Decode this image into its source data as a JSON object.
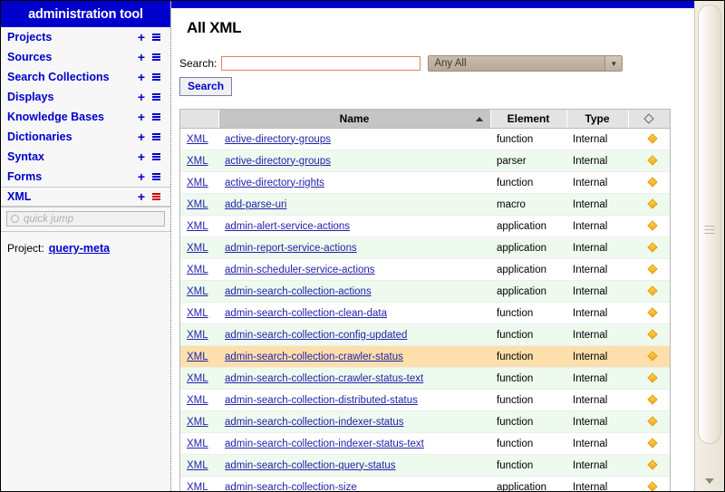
{
  "brand": {
    "title": "administration tool"
  },
  "sidebar": {
    "items": [
      {
        "label": "Projects",
        "add_icon": "plus-icon",
        "menu_icon": "hamburger-icon",
        "current": false
      },
      {
        "label": "Sources",
        "add_icon": "plus-icon",
        "menu_icon": "hamburger-icon",
        "current": false
      },
      {
        "label": "Search Collections",
        "add_icon": "plus-icon",
        "menu_icon": "hamburger-icon",
        "current": false
      },
      {
        "label": "Displays",
        "add_icon": "plus-icon",
        "menu_icon": "hamburger-icon",
        "current": false
      },
      {
        "label": "Knowledge Bases",
        "add_icon": "plus-icon",
        "menu_icon": "hamburger-icon",
        "current": false
      },
      {
        "label": "Dictionaries",
        "add_icon": "plus-icon",
        "menu_icon": "hamburger-icon",
        "current": false
      },
      {
        "label": "Syntax",
        "add_icon": "plus-icon",
        "menu_icon": "hamburger-icon",
        "current": false
      },
      {
        "label": "Forms",
        "add_icon": "plus-icon",
        "menu_icon": "hamburger-icon",
        "current": false
      },
      {
        "label": "XML",
        "add_icon": "plus-icon",
        "menu_icon": "hamburger-icon",
        "current": true
      }
    ],
    "quick_jump": {
      "icon": "circle-icon",
      "placeholder": "quick jump",
      "value": ""
    },
    "project": {
      "label": "Project:",
      "value": "query-meta"
    }
  },
  "main": {
    "page_title": "All XML",
    "search": {
      "label": "Search:",
      "value": "",
      "placeholder": "",
      "scope_selected": "Any All",
      "scope_arrow_icon": "chevron-down-icon",
      "button_label": "Search"
    },
    "table": {
      "columns": [
        "",
        "Name",
        "Element",
        "Type",
        "◇"
      ],
      "sorted_column": "Name",
      "sort_direction": "asc",
      "sort_icon": "caret-up-icon",
      "flag_header_icon": "diamond-outline-icon",
      "link_label": "XML",
      "rows": [
        {
          "link": "XML",
          "name": "active-directory-groups",
          "element": "function",
          "type": "Internal",
          "flag": "diamond-icon",
          "highlight": false
        },
        {
          "link": "XML",
          "name": "active-directory-groups",
          "element": "parser",
          "type": "Internal",
          "flag": "diamond-icon",
          "highlight": false
        },
        {
          "link": "XML",
          "name": "active-directory-rights",
          "element": "function",
          "type": "Internal",
          "flag": "diamond-icon",
          "highlight": false
        },
        {
          "link": "XML",
          "name": "add-parse-uri",
          "element": "macro",
          "type": "Internal",
          "flag": "diamond-icon",
          "highlight": false
        },
        {
          "link": "XML",
          "name": "admin-alert-service-actions",
          "element": "application",
          "type": "Internal",
          "flag": "diamond-icon",
          "highlight": false
        },
        {
          "link": "XML",
          "name": "admin-report-service-actions",
          "element": "application",
          "type": "Internal",
          "flag": "diamond-icon",
          "highlight": false
        },
        {
          "link": "XML",
          "name": "admin-scheduler-service-actions",
          "element": "application",
          "type": "Internal",
          "flag": "diamond-icon",
          "highlight": false
        },
        {
          "link": "XML",
          "name": "admin-search-collection-actions",
          "element": "application",
          "type": "Internal",
          "flag": "diamond-icon",
          "highlight": false
        },
        {
          "link": "XML",
          "name": "admin-search-collection-clean-data",
          "element": "function",
          "type": "Internal",
          "flag": "diamond-icon",
          "highlight": false
        },
        {
          "link": "XML",
          "name": "admin-search-collection-config-updated",
          "element": "function",
          "type": "Internal",
          "flag": "diamond-icon",
          "highlight": false
        },
        {
          "link": "XML",
          "name": "admin-search-collection-crawler-status",
          "element": "function",
          "type": "Internal",
          "flag": "diamond-icon",
          "highlight": true
        },
        {
          "link": "XML",
          "name": "admin-search-collection-crawler-status-text",
          "element": "function",
          "type": "Internal",
          "flag": "diamond-icon",
          "highlight": false
        },
        {
          "link": "XML",
          "name": "admin-search-collection-distributed-status",
          "element": "function",
          "type": "Internal",
          "flag": "diamond-icon",
          "highlight": false
        },
        {
          "link": "XML",
          "name": "admin-search-collection-indexer-status",
          "element": "function",
          "type": "Internal",
          "flag": "diamond-icon",
          "highlight": false
        },
        {
          "link": "XML",
          "name": "admin-search-collection-indexer-status-text",
          "element": "function",
          "type": "Internal",
          "flag": "diamond-icon",
          "highlight": false
        },
        {
          "link": "XML",
          "name": "admin-search-collection-query-status",
          "element": "function",
          "type": "Internal",
          "flag": "diamond-icon",
          "highlight": false
        },
        {
          "link": "XML",
          "name": "admin-search-collection-size",
          "element": "application",
          "type": "Internal",
          "flag": "diamond-icon",
          "highlight": false
        }
      ]
    }
  },
  "scrollbar": {
    "thumb_grip_icon": "grip-lines-icon",
    "down_arrow_icon": "caret-down-icon"
  },
  "colors": {
    "brand_blue": "#0000cc",
    "link_blue": "#2222aa",
    "highlight_row": "#fcdfab",
    "alt_row": "#eefaee",
    "flag_yellow": "#f0a81e",
    "header_sorted": "#c5c5c5"
  }
}
